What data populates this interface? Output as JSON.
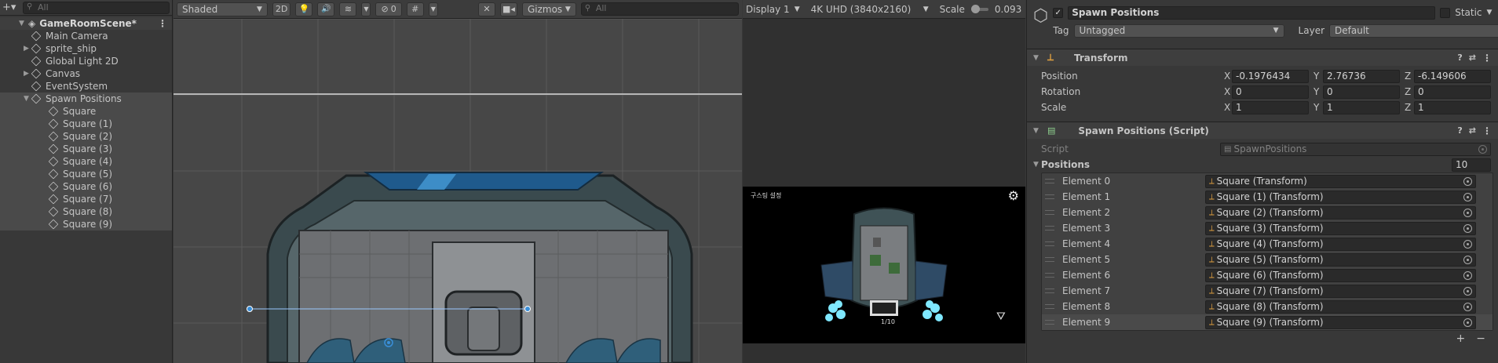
{
  "hierarchy": {
    "search_placeholder": "All",
    "scene_name": "GameRoomScene*",
    "items": [
      {
        "label": "Main Camera",
        "expandable": false,
        "depth": 1,
        "selected": false
      },
      {
        "label": "sprite_ship",
        "expandable": true,
        "depth": 1,
        "selected": false
      },
      {
        "label": "Global Light 2D",
        "expandable": false,
        "depth": 1,
        "selected": false
      },
      {
        "label": "Canvas",
        "expandable": true,
        "depth": 1,
        "selected": false
      },
      {
        "label": "EventSystem",
        "expandable": false,
        "depth": 1,
        "selected": false
      },
      {
        "label": "Spawn Positions",
        "expandable": true,
        "depth": 1,
        "selected": true
      },
      {
        "label": "Square",
        "depth": 2,
        "selected": true
      },
      {
        "label": "Square (1)",
        "depth": 2,
        "selected": true
      },
      {
        "label": "Square (2)",
        "depth": 2,
        "selected": true
      },
      {
        "label": "Square (3)",
        "depth": 2,
        "selected": true
      },
      {
        "label": "Square (4)",
        "depth": 2,
        "selected": true
      },
      {
        "label": "Square (5)",
        "depth": 2,
        "selected": true
      },
      {
        "label": "Square (6)",
        "depth": 2,
        "selected": true
      },
      {
        "label": "Square (7)",
        "depth": 2,
        "selected": true
      },
      {
        "label": "Square (8)",
        "depth": 2,
        "selected": true
      },
      {
        "label": "Square (9)",
        "depth": 2,
        "selected": true
      }
    ]
  },
  "scene": {
    "shading_mode": "Shaded",
    "mode_2d": "2D",
    "hidden_count": "0",
    "gizmos": "Gizmos",
    "search_placeholder": "All"
  },
  "game": {
    "display": "Display 1",
    "resolution": "4K UHD (3840x2160)",
    "scale_label": "Scale",
    "scale_value": "0.093",
    "overlay_text": "구스팅 설정",
    "bottom_text": "1/10"
  },
  "inspector": {
    "object_name": "Spawn Positions",
    "static_label": "Static",
    "tag_label": "Tag",
    "tag_value": "Untagged",
    "layer_label": "Layer",
    "layer_value": "Default",
    "transform": {
      "title": "Transform",
      "position_label": "Position",
      "rotation_label": "Rotation",
      "scale_label": "Scale",
      "position": {
        "x": "-0.1976434",
        "y": "2.76736",
        "z": "-6.149606"
      },
      "rotation": {
        "x": "0",
        "y": "0",
        "z": "0"
      },
      "scale": {
        "x": "1",
        "y": "1",
        "z": "1"
      }
    },
    "script_component": {
      "title": "Spawn Positions (Script)",
      "script_label": "Script",
      "script_value": "SpawnPositions",
      "positions_label": "Positions",
      "positions_count": "10",
      "elements": [
        {
          "label": "Element 0",
          "value": "Square (Transform)"
        },
        {
          "label": "Element 1",
          "value": "Square (1) (Transform)"
        },
        {
          "label": "Element 2",
          "value": "Square (2) (Transform)"
        },
        {
          "label": "Element 3",
          "value": "Square (3) (Transform)"
        },
        {
          "label": "Element 4",
          "value": "Square (4) (Transform)"
        },
        {
          "label": "Element 5",
          "value": "Square (5) (Transform)"
        },
        {
          "label": "Element 6",
          "value": "Square (6) (Transform)"
        },
        {
          "label": "Element 7",
          "value": "Square (7) (Transform)"
        },
        {
          "label": "Element 8",
          "value": "Square (8) (Transform)"
        },
        {
          "label": "Element 9",
          "value": "Square (9) (Transform)"
        }
      ],
      "add_label": "+",
      "remove_label": "−"
    }
  },
  "colors": {
    "panel": "#383838",
    "selection": "#4a4a4a",
    "accent_blue": "#3a8fd9",
    "scene_bg": "#474747"
  }
}
